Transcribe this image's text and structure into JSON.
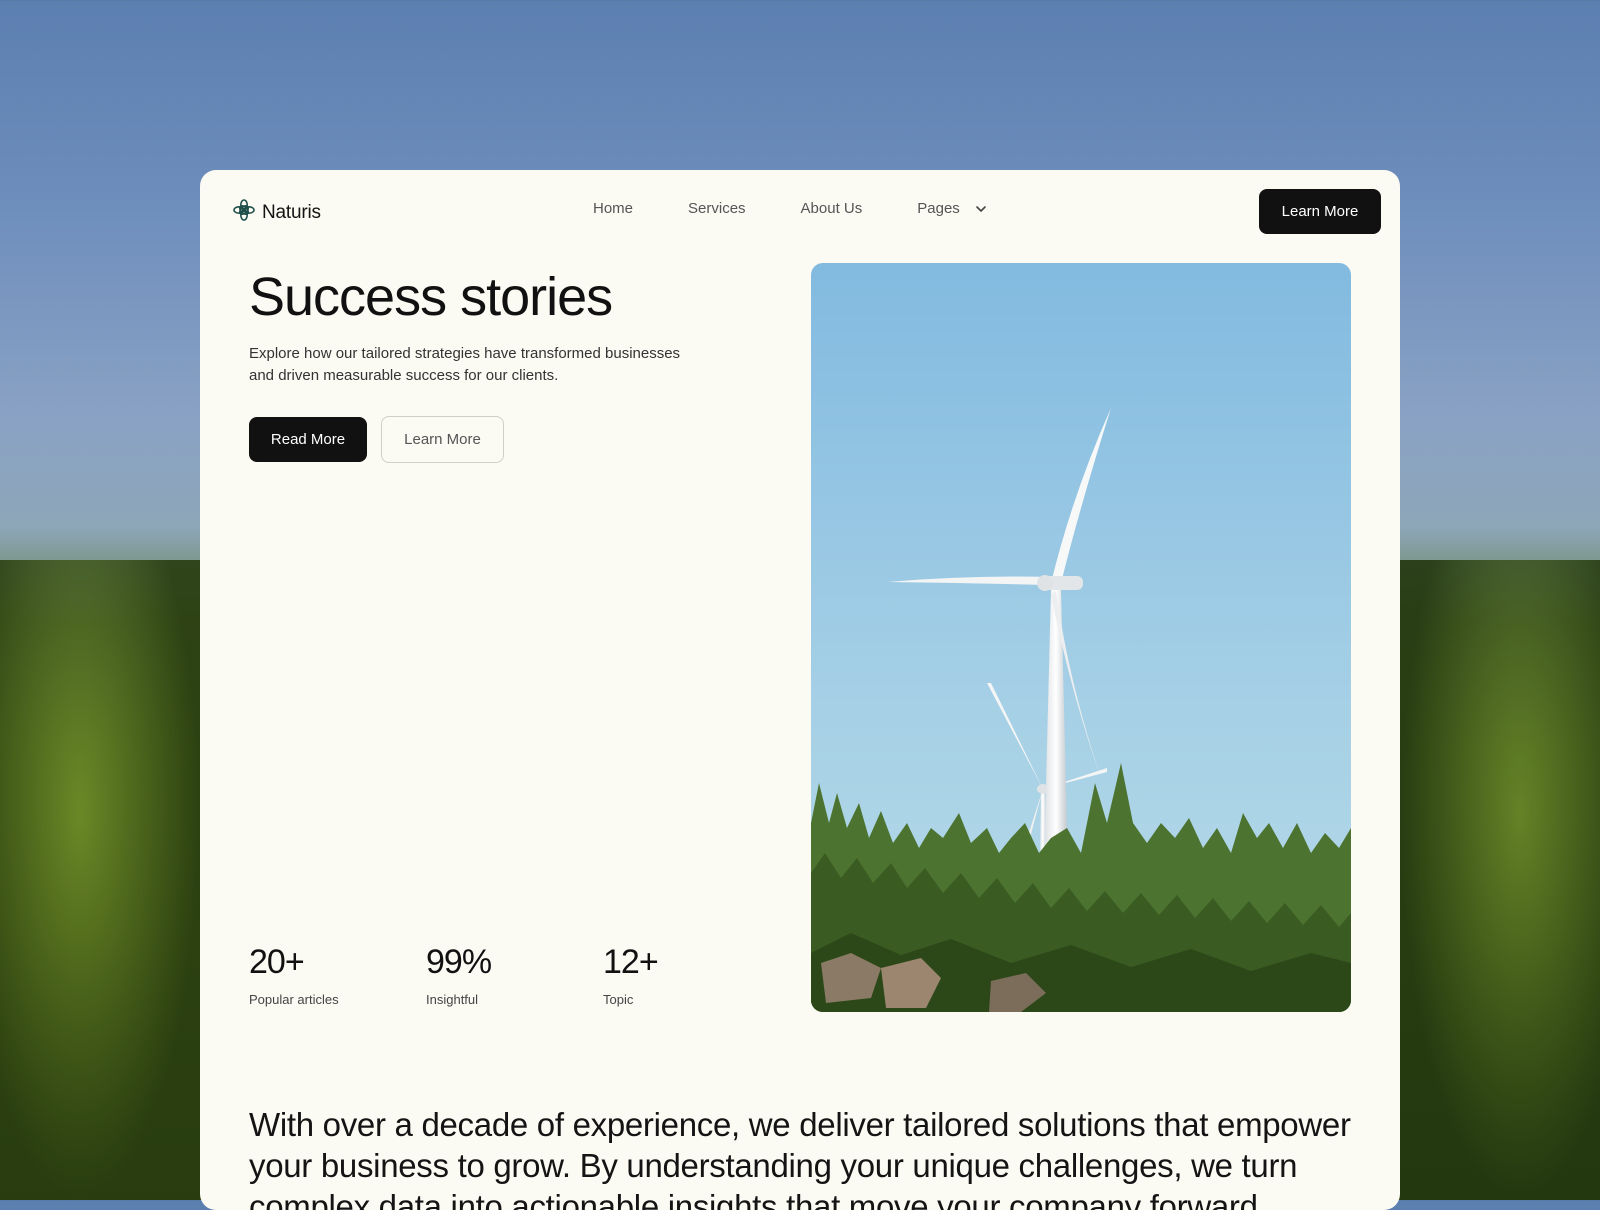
{
  "brand": {
    "name": "Naturis",
    "logo_icon": "flower-logo-icon",
    "accent": "#1f4f4a"
  },
  "nav": {
    "links": [
      {
        "label": "Home"
      },
      {
        "label": "Services"
      },
      {
        "label": "About Us"
      },
      {
        "label": "Pages",
        "icon": "chevron-down-icon"
      }
    ],
    "cta_label": "Learn More"
  },
  "hero": {
    "title": "Success stories",
    "description": "Explore how our tailored strategies have transformed businesses and driven measurable success for our clients.",
    "primary_button": "Read More",
    "secondary_button": "Learn More",
    "image": "wind-turbines-forest-photo"
  },
  "stats": [
    {
      "value": "20+",
      "label": "Popular articles"
    },
    {
      "value": "99%",
      "label": "Insightful"
    },
    {
      "value": "12+",
      "label": "Topic"
    }
  ],
  "about": {
    "text": "With over a decade of experience, we deliver tailored solutions that empower your business to grow. By understanding your unique challenges, we turn complex data into actionable insights that move your company forward."
  },
  "colors": {
    "card_bg": "#fbfaf3",
    "button_dark": "#111111",
    "sky": "#8cc0e0",
    "forest": "#3d5f22"
  }
}
